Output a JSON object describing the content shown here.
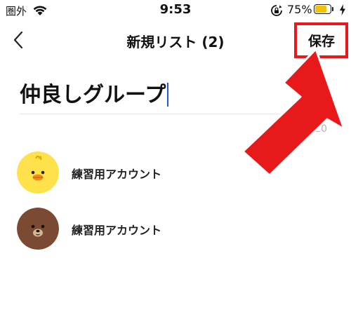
{
  "status_bar": {
    "carrier": "圏外",
    "time": "9:53",
    "battery_percent_label": "75%",
    "battery_level": 0.75,
    "icons": [
      "wifi-icon",
      "rotation-lock-icon",
      "battery-icon",
      "charging-icon"
    ]
  },
  "nav": {
    "back_icon": "chevron-left-icon",
    "title": "新規リスト (2)",
    "save_label": "保存"
  },
  "group_name": {
    "value": "仲良しグループ",
    "clear_icon": "clear-circle-icon",
    "char_count": "7/20"
  },
  "members": [
    {
      "name": "練習用アカウント",
      "avatar": "sally-chick-avatar"
    },
    {
      "name": "練習用アカウント",
      "avatar": "brown-bear-avatar"
    }
  ],
  "colors": {
    "highlight_red": "#e8191b",
    "cursor_blue": "#1f5bd8",
    "battery_yellow": "#f2c200",
    "sally_yellow": "#ffe14b",
    "brown_bear": "#7a4a32",
    "counter_gray": "#b5b5b5"
  }
}
